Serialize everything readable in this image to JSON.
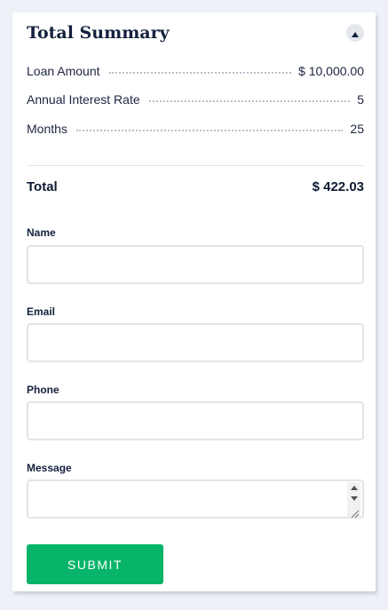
{
  "summary": {
    "title": "Total Summary",
    "collapse_icon": "caret-up-icon",
    "rows": [
      {
        "label": "Loan Amount",
        "value": "$ 10,000.00"
      },
      {
        "label": "Annual Interest Rate",
        "value": "5"
      },
      {
        "label": "Months",
        "value": "25"
      }
    ],
    "total_label": "Total",
    "total_value": "$ 422.03"
  },
  "form": {
    "name_label": "Name",
    "name_value": "",
    "email_label": "Email",
    "email_value": "",
    "phone_label": "Phone",
    "phone_value": "",
    "message_label": "Message",
    "message_value": "",
    "submit_label": "SUBMIT"
  },
  "colors": {
    "page_background": "#eef1f7",
    "card_background": "#ffffff",
    "submit_button": "#07b469",
    "heading_text": "#14213d"
  }
}
